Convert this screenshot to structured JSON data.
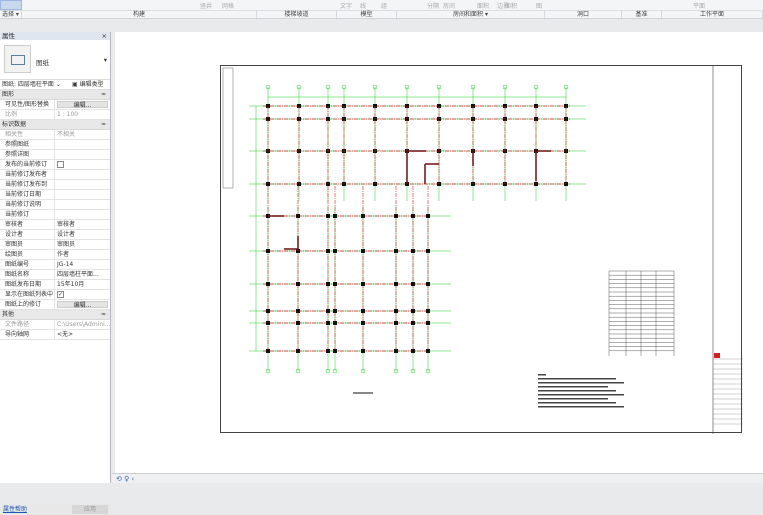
{
  "ribbon": {
    "tools": [
      "竖井",
      "网格",
      "文字",
      "线",
      "组",
      "分隔",
      "房间",
      "面积",
      "边界",
      "面积",
      "图",
      "平面"
    ],
    "panels": [
      "选择 ▾",
      "构建",
      "楼梯坡道",
      "模型",
      "房间和面积 ▾",
      "洞口",
      "基准",
      "工作平面"
    ]
  },
  "properties": {
    "title": "属性",
    "close": "×",
    "type_name": "图纸",
    "filter_value": "图纸: 四层墙柱平面",
    "edit_type": "编辑类型",
    "groups": [
      {
        "name": "图形",
        "rows": [
          {
            "key": "可见性/图形替换",
            "button": "编辑..."
          },
          {
            "key": "比例",
            "value": "1 : 100",
            "dim": true
          }
        ]
      },
      {
        "name": "标识数据",
        "rows": [
          {
            "key": "相关性",
            "value": "不相关",
            "dim": true
          },
          {
            "key": "参照图纸",
            "value": ""
          },
          {
            "key": "参照详图",
            "value": ""
          },
          {
            "key": "发布的当前修订",
            "checkbox": false
          },
          {
            "key": "当前修订发布者",
            "value": ""
          },
          {
            "key": "当前修订发布到",
            "value": ""
          },
          {
            "key": "当前修订日期",
            "value": ""
          },
          {
            "key": "当前修订说明",
            "value": ""
          },
          {
            "key": "当前修订",
            "value": ""
          },
          {
            "key": "审核者",
            "value": "审核者"
          },
          {
            "key": "设计者",
            "value": "设计者"
          },
          {
            "key": "审图员",
            "value": "审图员"
          },
          {
            "key": "绘图员",
            "value": "作者"
          },
          {
            "key": "图纸编号",
            "value": "JG-14"
          },
          {
            "key": "图纸名称",
            "value": "四层墙柱平面..."
          },
          {
            "key": "图纸发布日期",
            "value": "15年10月"
          },
          {
            "key": "显示在图纸列表中",
            "checkbox": true
          },
          {
            "key": "图纸上的修订",
            "button": "编辑..."
          }
        ]
      },
      {
        "name": "其他",
        "rows": [
          {
            "key": "文件路径",
            "value": "C:\\Users\\Admini...",
            "dim": true
          },
          {
            "key": "导向轴网",
            "value": "<无>"
          }
        ]
      }
    ],
    "help_link": "属性帮助",
    "apply": "应用"
  },
  "status": {
    "icons": [
      "orbit-icon",
      "pin-icon",
      "chevron-left-icon"
    ],
    "text": "⟲ ♀ ‹"
  },
  "colors": {
    "grid": "#22cc22",
    "beam": "#d22020",
    "column": "#111111",
    "accent": "#1f56b0"
  }
}
